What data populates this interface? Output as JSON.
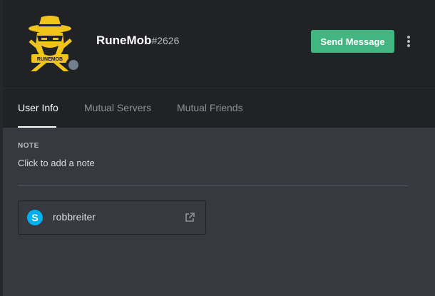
{
  "profile": {
    "username": "RuneMob",
    "discriminator": "#2626",
    "avatar_text": "RUNEMOB",
    "status": "offline"
  },
  "header": {
    "send_message_label": "Send Message",
    "more_icon": "vertical-ellipsis-icon"
  },
  "tabs": [
    {
      "label": "User Info",
      "active": true
    },
    {
      "label": "Mutual Servers",
      "active": false
    },
    {
      "label": "Mutual Friends",
      "active": false
    }
  ],
  "note": {
    "label": "NOTE",
    "placeholder": "Click to add a note"
  },
  "connected_accounts": [
    {
      "service": "skype",
      "icon": "skype-icon",
      "name": "robbreiter",
      "action_icon": "external-link-icon"
    }
  ],
  "colors": {
    "accent_green": "#43b581",
    "avatar_yellow": "#f0c419",
    "status_offline": "#747f8d",
    "skype_blue": "#00aff0"
  }
}
